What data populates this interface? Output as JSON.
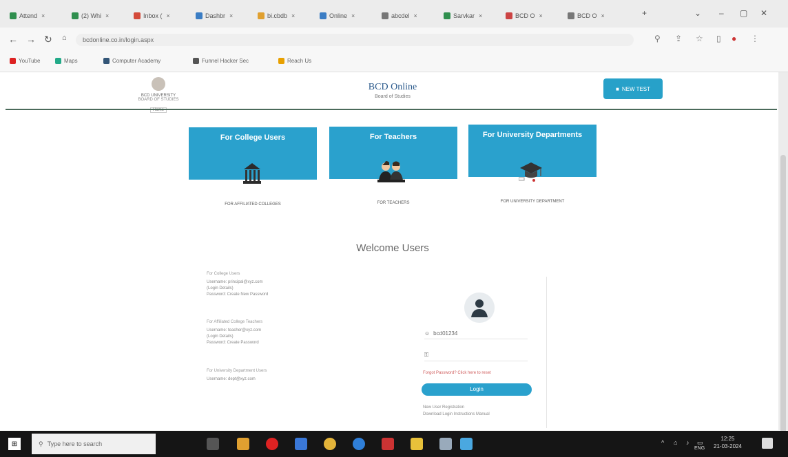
{
  "browser": {
    "tabs": [
      {
        "label": "Attend",
        "color": "#2f8f4e"
      },
      {
        "label": "(2) Whi",
        "color": "#2f8f4e"
      },
      {
        "label": "Inbox (",
        "color": "#d44a3a"
      },
      {
        "label": "Dashbr",
        "color": "#3b7dc4"
      },
      {
        "label": "bi.cbdb",
        "color": "#e0a030"
      },
      {
        "label": "Online",
        "color": "#3b7dc4"
      },
      {
        "label": "abcdel",
        "color": "#777777"
      },
      {
        "label": "Sarvkar",
        "color": "#2f8f4e"
      },
      {
        "label": "BCD O",
        "color": "#c44"
      },
      {
        "label": "BCD O",
        "color": "#777777"
      }
    ],
    "new_tab": "+",
    "url": "bcdonline.co.in/login.aspx",
    "bookmarks": [
      {
        "label": "YouTube",
        "color": "#d22"
      },
      {
        "label": "Maps",
        "color": "#2a8"
      },
      {
        "label": "Computer Academy",
        "color": "#357"
      },
      {
        "label": "Funnel Hacker Sec",
        "color": "#555"
      },
      {
        "label": "Reach Us",
        "color": "#e8a000"
      }
    ]
  },
  "site": {
    "logo_line1": "BCD UNIVERSITY",
    "logo_line2": "BOARD OF STUDIES",
    "logo_line3": "Home",
    "title": "BCD Online",
    "subtitle": "Board of Studies",
    "header_button": "NEW TEST"
  },
  "cards": [
    {
      "title": "For College Users",
      "caption": "FOR AFFILIATED COLLEGES",
      "icon": "building-icon"
    },
    {
      "title": "For Teachers",
      "caption": "FOR TEACHERS",
      "icon": "teachers-icon"
    },
    {
      "title": "For University Departments",
      "caption": "FOR UNIVERSITY DEPARTMENT",
      "icon": "graduation-cap-icon"
    }
  ],
  "welcome": "Welcome Users",
  "info": [
    {
      "heading": "For College Users",
      "lines": [
        "Username: principal@xyz.com",
        "(Login Details)",
        "Password: Create New Password"
      ]
    },
    {
      "heading": "For Affiliated College Teachers",
      "lines": [
        "Username: teacher@xyz.com",
        "(Login Details)",
        "Password: Create Password"
      ]
    },
    {
      "heading": "For University Department Users",
      "lines": [
        "Username: dept@xyz.com"
      ]
    }
  ],
  "login": {
    "username_value": "bcd01234",
    "password_placeholder": "",
    "forgot": "Forgot Password? Click here to reset",
    "button": "Login",
    "links": [
      "New User Registration",
      "Download Login Instructions Manual"
    ]
  },
  "taskbar": {
    "search_placeholder": "Type here to search",
    "time": "12:25",
    "date": "21-03-2024",
    "lang": "ENG"
  }
}
